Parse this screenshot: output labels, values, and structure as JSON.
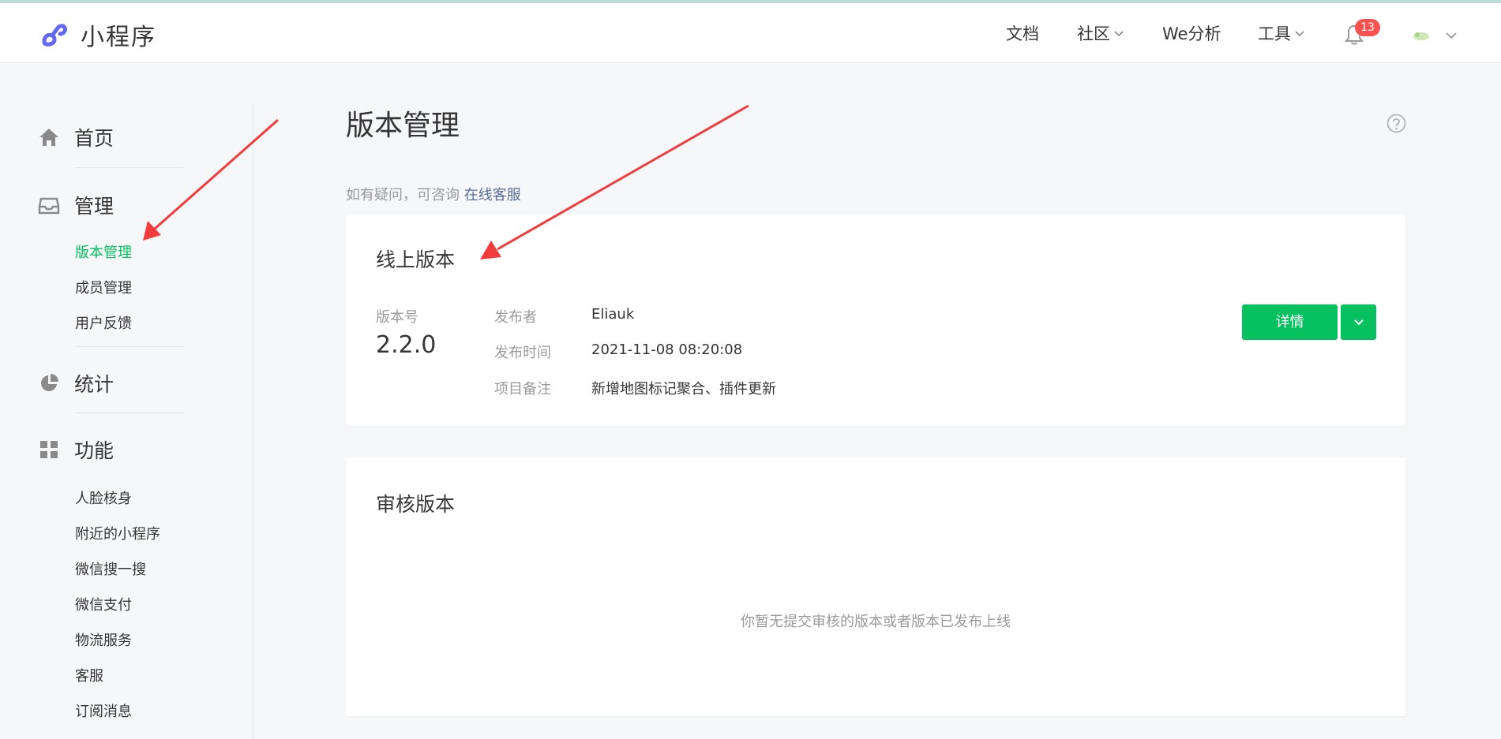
{
  "header": {
    "app_name": "小程序",
    "nav": {
      "docs": "文档",
      "community": "社区",
      "we_analysis": "We分析",
      "tools": "工具"
    },
    "notification_count": "13",
    "accent_color": "#07c160",
    "badge_color": "#fa5151"
  },
  "sidebar": {
    "home": "首页",
    "manage": "管理",
    "manage_items": [
      "版本管理",
      "成员管理",
      "用户反馈"
    ],
    "stats": "统计",
    "features": "功能",
    "feature_items": [
      "人脸核身",
      "附近的小程序",
      "微信搜一搜",
      "微信支付",
      "物流服务",
      "客服",
      "订阅消息"
    ]
  },
  "main": {
    "title": "版本管理",
    "tip_prefix": "如有疑问，可咨询",
    "tip_link": "在线客服",
    "online": {
      "title": "线上版本",
      "version_label": "版本号",
      "version": "2.2.0",
      "publisher_label": "发布者",
      "publisher": "Eliauk",
      "time_label": "发布时间",
      "time": "2021-11-08 08:20:08",
      "note_label": "项目备注",
      "note": "新增地图标记聚合、插件更新",
      "detail_button": "详情"
    },
    "review": {
      "title": "审核版本",
      "empty": "你暂无提交审核的版本或者版本已发布上线"
    }
  }
}
